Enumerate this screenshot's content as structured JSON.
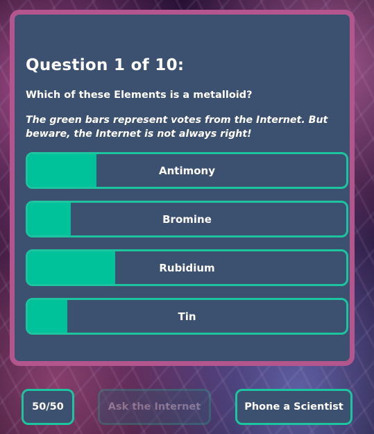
{
  "question": {
    "heading": "Question 1 of 10:",
    "text": "Which of these Elements is a metalloid?",
    "hint": "The green bars represent votes from the Internet. But beware, the Internet is not always right!"
  },
  "answers": [
    {
      "label": "Antimony",
      "vote_fraction": 0.215
    },
    {
      "label": "Bromine",
      "vote_fraction": 0.135
    },
    {
      "label": "Rubidium",
      "vote_fraction": 0.275
    },
    {
      "label": "Tin",
      "vote_fraction": 0.125
    }
  ],
  "lifelines": {
    "fifty_fifty": {
      "label": "50/50",
      "enabled": true
    },
    "ask_internet": {
      "label": "Ask the Internet",
      "enabled": false
    },
    "phone_scientist": {
      "label": "Phone a Scientist",
      "enabled": true
    }
  },
  "colors": {
    "panel_background": "#3c5170",
    "panel_border": "#b3568e",
    "accent": "#1dc4a0",
    "vote_bar": "#00c29a"
  }
}
